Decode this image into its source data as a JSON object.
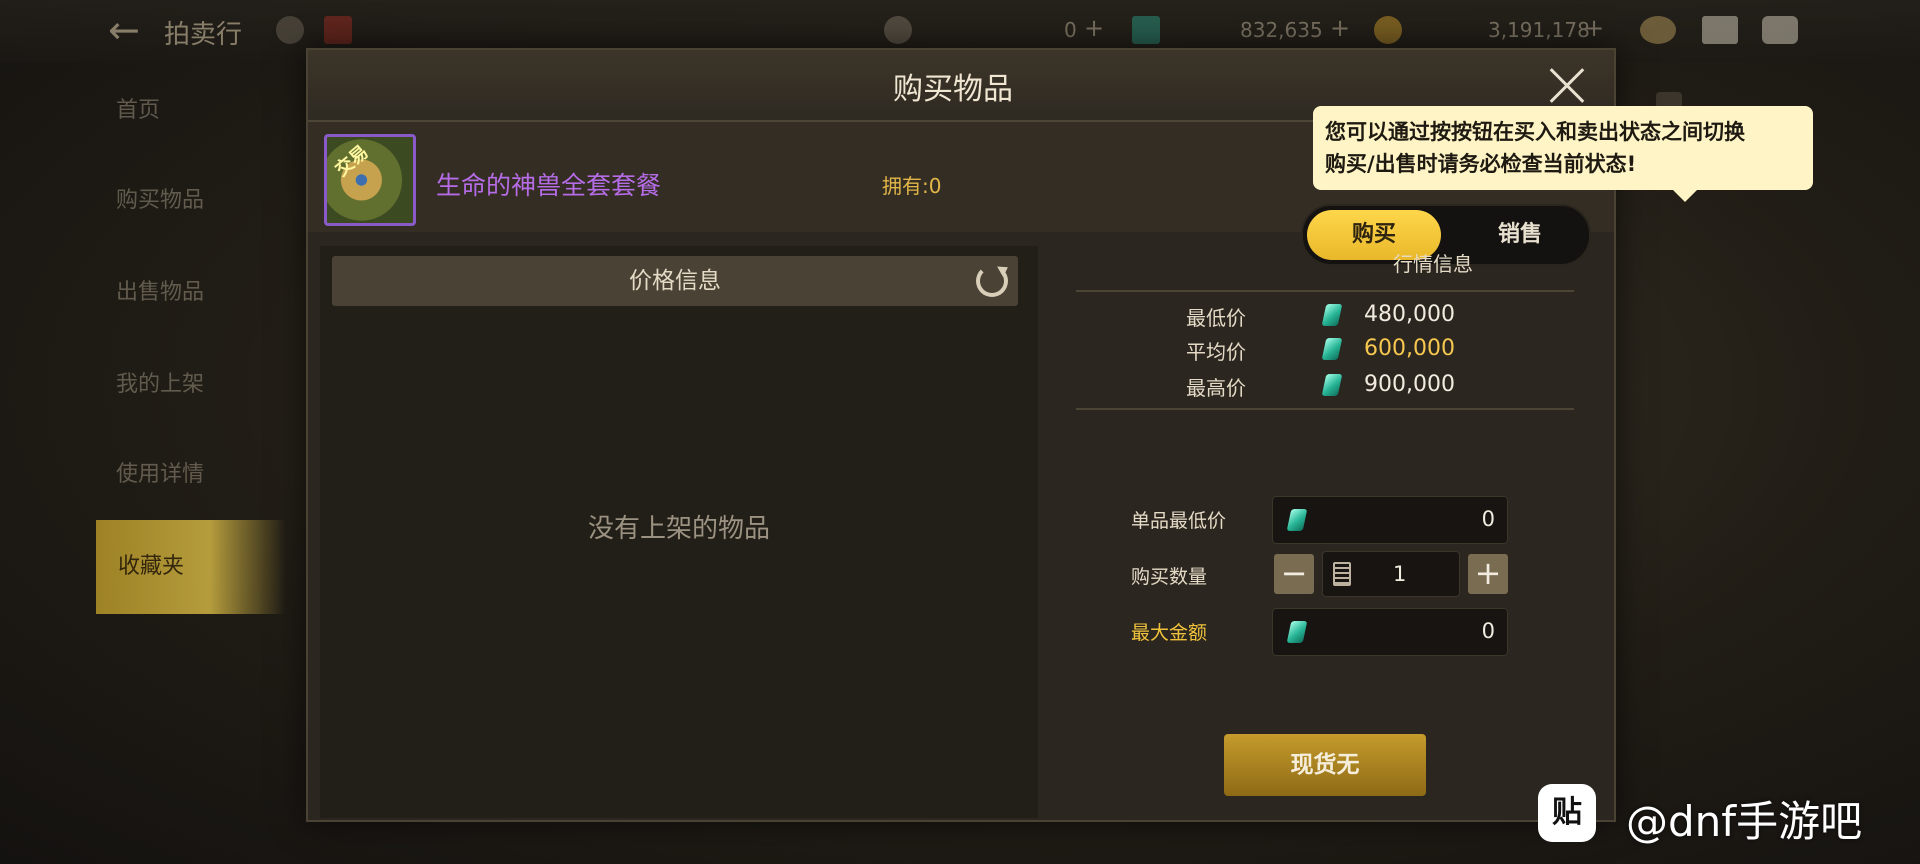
{
  "topbar": {
    "back_icon": "back-arrow-icon",
    "title": "拍卖行",
    "currencies": [
      {
        "icon": "moon-coin-icon",
        "value": "0"
      },
      {
        "icon": "gem-icon",
        "value": "832,635"
      },
      {
        "icon": "gold-coin-icon",
        "value": "3,191,178"
      }
    ]
  },
  "sidebar": {
    "items": [
      {
        "label": "首页"
      },
      {
        "label": "购买物品"
      },
      {
        "label": "出售物品"
      },
      {
        "label": "我的上架"
      },
      {
        "label": "使用详情"
      },
      {
        "label": "收藏夹"
      }
    ]
  },
  "dialog": {
    "title": "购买物品",
    "tooltip": [
      "您可以通过按按钮在买入和卖出状态之间切换",
      "购买/出售时请务必检查当前状态!"
    ],
    "item": {
      "name": "生命的神兽全套套餐",
      "badge": "交易",
      "owned": "拥有:0"
    },
    "toggle": {
      "buy": "购买",
      "sell": "销售"
    },
    "price_info": {
      "header": "价格信息",
      "empty": "没有上架的物品"
    },
    "market": {
      "title": "行情信息",
      "rows": [
        {
          "label": "最低价",
          "value": "480,000"
        },
        {
          "label": "平均价",
          "value": "600,000"
        },
        {
          "label": "最高价",
          "value": "900,000"
        }
      ]
    },
    "form": {
      "min_unit_price_label": "单品最低价",
      "min_unit_price": "0",
      "quantity_label": "购买数量",
      "quantity": "1",
      "max_total_label": "最大金额",
      "max_total": "0"
    },
    "action_button": "现货无"
  },
  "watermark": {
    "logo": "贴",
    "text": "@dnf手游吧"
  },
  "colors": {
    "accent_gold": "#f6c850",
    "item_purple": "#b56ce6",
    "gem": "#27b495"
  }
}
